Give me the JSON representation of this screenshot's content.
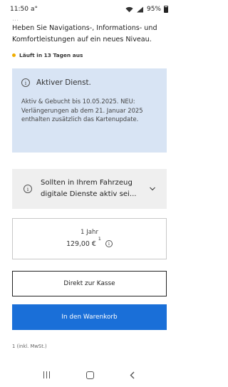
{
  "status_bar": {
    "time": "11:50",
    "left_icons": "a°",
    "battery": "95%"
  },
  "intro": {
    "faded_line": "...",
    "text": "Heben Sie Navigations-, Informations- und Komfortleistungen auf ein neues Niveau."
  },
  "expiry_notice": "Läuft in 13 Tagen aus",
  "info_card": {
    "title": "Aktiver Dienst.",
    "body": "Aktiv & Gebucht bis 10.05.2025. NEU: Verlängerungen ab dem 21. Januar 2025 enthalten zusätzlich das Kartenupdate."
  },
  "collapsible": {
    "text": "Sollten in Ihrem Fahrzeug digitale Dienste aktiv sei..."
  },
  "price": {
    "duration": "1 Jahr",
    "amount": "129,00 €",
    "footnote_marker": "1"
  },
  "buttons": {
    "checkout": "Direkt zur Kasse",
    "add_to_cart": "In den Warenkorb"
  },
  "footnote": "1  (inkl. MwSt.)",
  "colors": {
    "accent_blue": "#1a6fd8",
    "info_bg": "#d8e4f4",
    "warning_dot": "#f0ad00"
  }
}
